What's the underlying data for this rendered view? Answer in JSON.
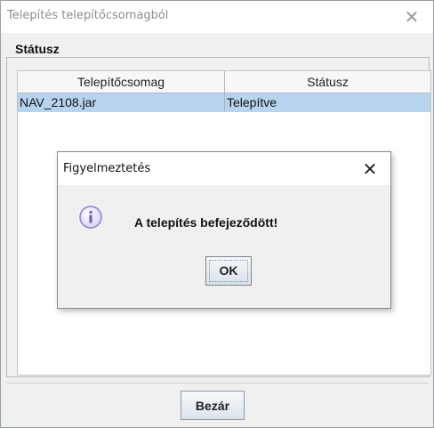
{
  "window": {
    "title": "Telepítés telepítőcsomagból",
    "close_glyph": "✕",
    "group_label": "Státusz",
    "table": {
      "columns": [
        "Telepítőcsomag",
        "Státusz"
      ],
      "rows": [
        [
          "NAV_2108.jar",
          "Telepítve"
        ]
      ]
    },
    "close_button_label": "Bezár"
  },
  "dialog": {
    "title": "Figyelmeztetés",
    "close_glyph": "✕",
    "icon": "info-icon",
    "message": "A telepítés befejeződött!",
    "ok_label": "OK"
  },
  "colors": {
    "selection": "#b7d3ee",
    "info_icon": "#8a7fd6"
  }
}
